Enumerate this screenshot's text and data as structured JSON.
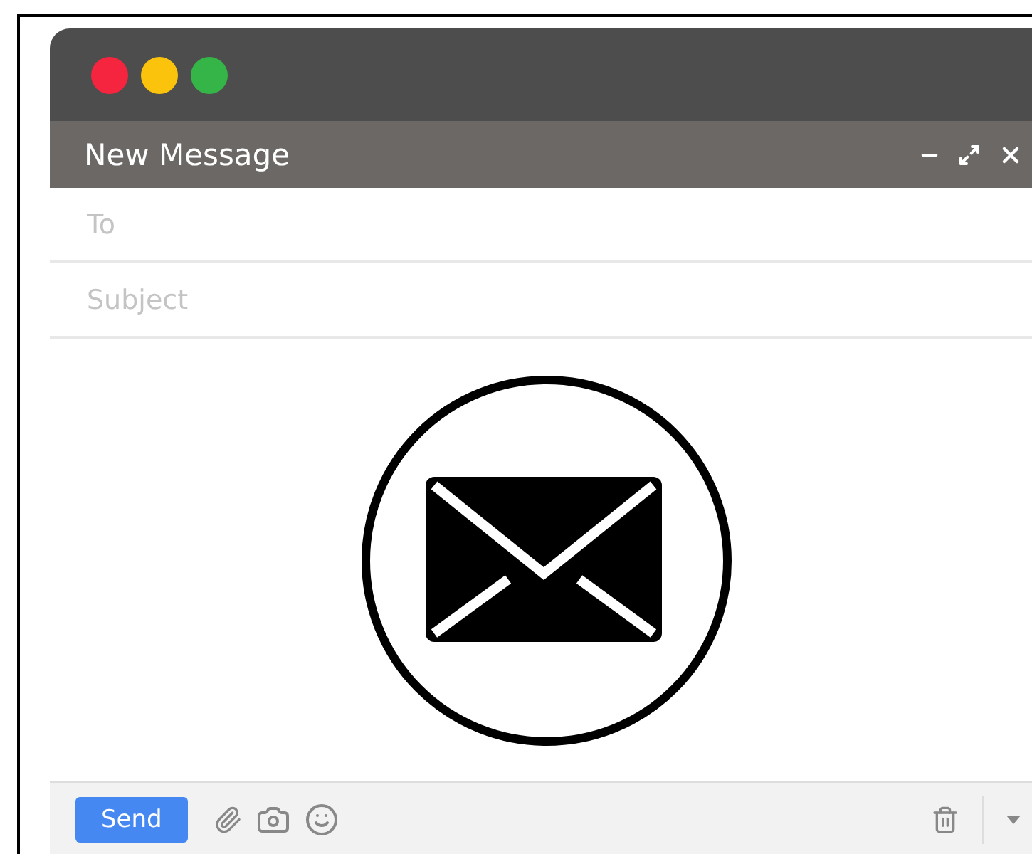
{
  "window": {
    "title": "New Message",
    "traffic_lights": [
      {
        "color": "#f5243f"
      },
      {
        "color": "#fbc30b"
      },
      {
        "color": "#35b548"
      }
    ]
  },
  "fields": [
    {
      "placeholder": "To"
    },
    {
      "placeholder": "Subject"
    }
  ],
  "footer": {
    "send_button": "Send"
  }
}
